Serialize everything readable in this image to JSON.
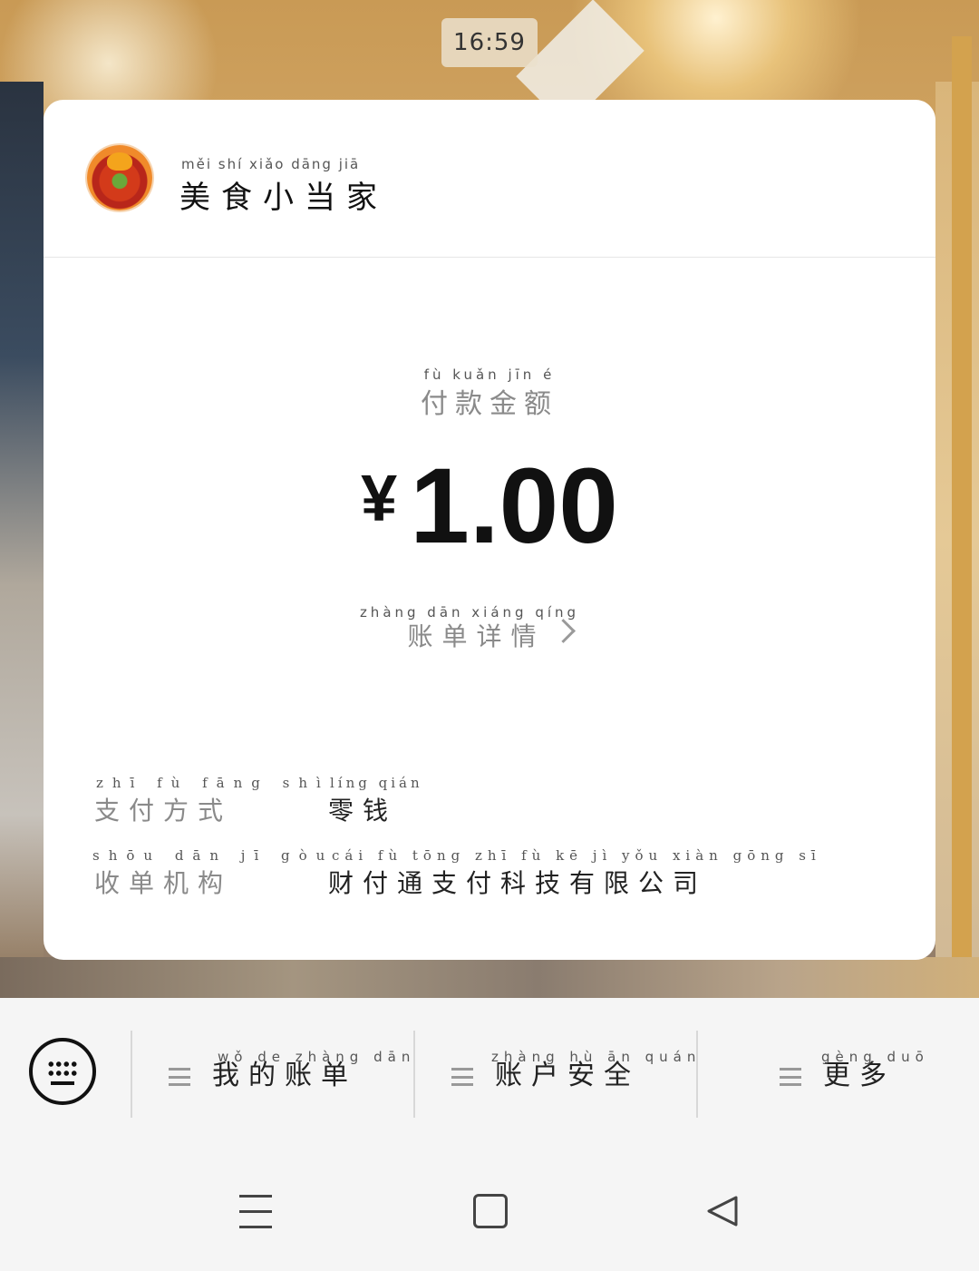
{
  "status": {
    "time": "16:59"
  },
  "merchant": {
    "name": "美食小当家",
    "name_pinyin": "měi shí xiǎo dāng jiā"
  },
  "payment": {
    "amount_label": "付款金额",
    "amount_label_pinyin": "fù kuǎn jīn é",
    "currency": "¥",
    "amount": "1.00",
    "detail_link": "账单详情",
    "detail_link_pinyin": "zhàng dān xiáng qíng"
  },
  "info": [
    {
      "label": "支付方式",
      "label_pinyin": "zhī fù fāng shì",
      "value": "零钱",
      "value_pinyin": "líng qián"
    },
    {
      "label": "收单机构",
      "label_pinyin": "shōu dān jī gòu",
      "value": "财付通支付科技有限公司",
      "value_pinyin": "cái fù tōng zhī fù kē jì yǒu xiàn gōng sī"
    }
  ],
  "menu": [
    {
      "label": "我的账单",
      "pinyin": "wǒ de zhàng dān"
    },
    {
      "label": "账户安全",
      "pinyin": "zhàng hù ān quán"
    },
    {
      "label": "更多",
      "pinyin": "gèng duō"
    }
  ],
  "icons": {
    "keyboard": "keyboard-icon",
    "menu": "hamburger-icon",
    "chevron": "chevron-right-icon"
  }
}
